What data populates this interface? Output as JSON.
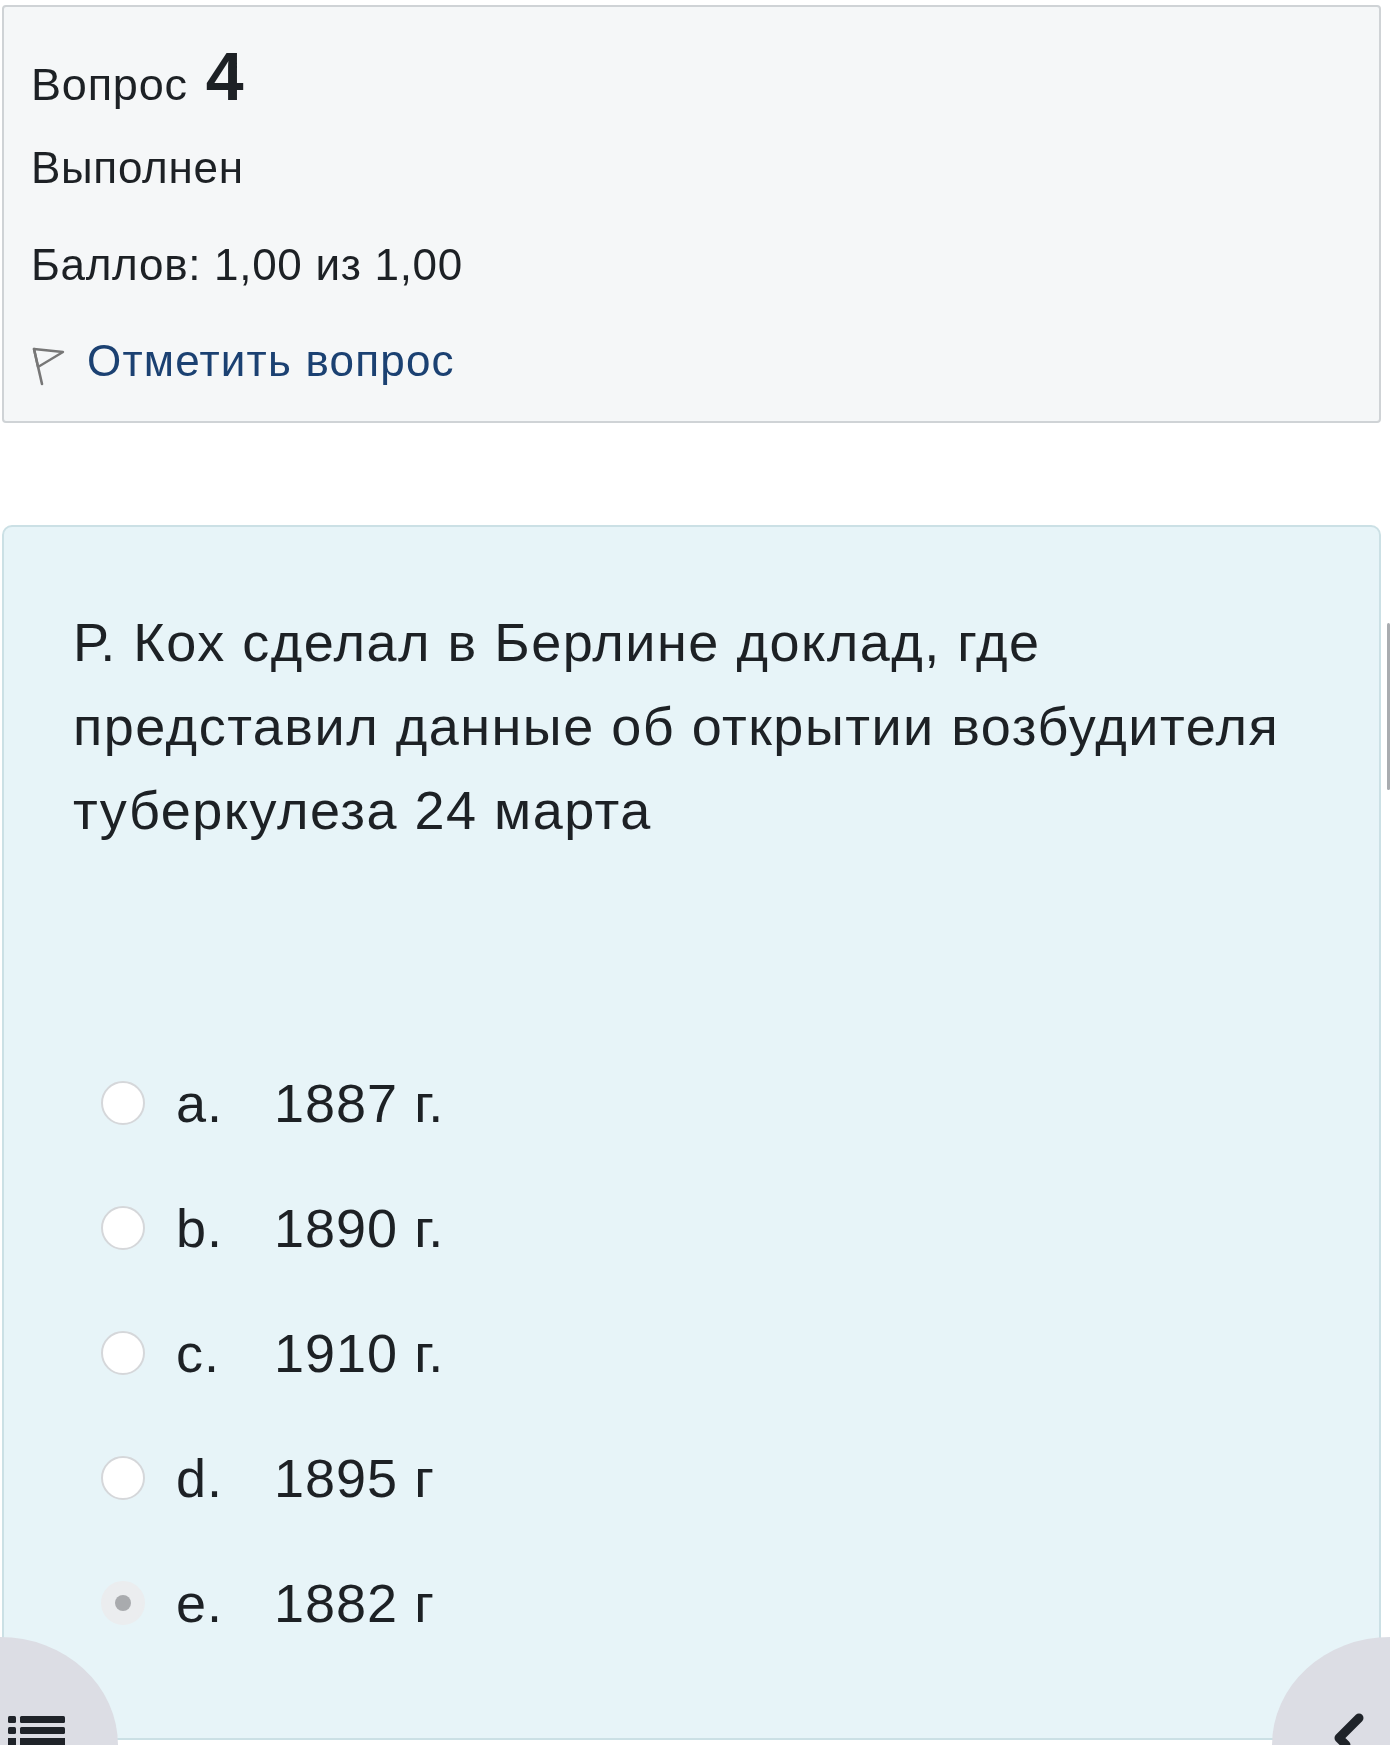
{
  "question_info": {
    "label": "Вопрос",
    "number": "4",
    "state": "Выполнен",
    "grade": "Баллов: 1,00 из 1,00",
    "flag_link": "Отметить вопрос"
  },
  "question": {
    "text": "Р. Кох сделал в Берлине доклад, где представил данные об открытии возбудителя туберкулеза 24 марта",
    "options": [
      {
        "letter": "a.",
        "answer": "1887 г.",
        "selected": false
      },
      {
        "letter": "b.",
        "answer": "1890 г.",
        "selected": false
      },
      {
        "letter": "c.",
        "answer": "1910 г.",
        "selected": false
      },
      {
        "letter": "d.",
        "answer": "1895 г",
        "selected": false
      },
      {
        "letter": "e.",
        "answer": "1882 г",
        "selected": true
      }
    ]
  }
}
